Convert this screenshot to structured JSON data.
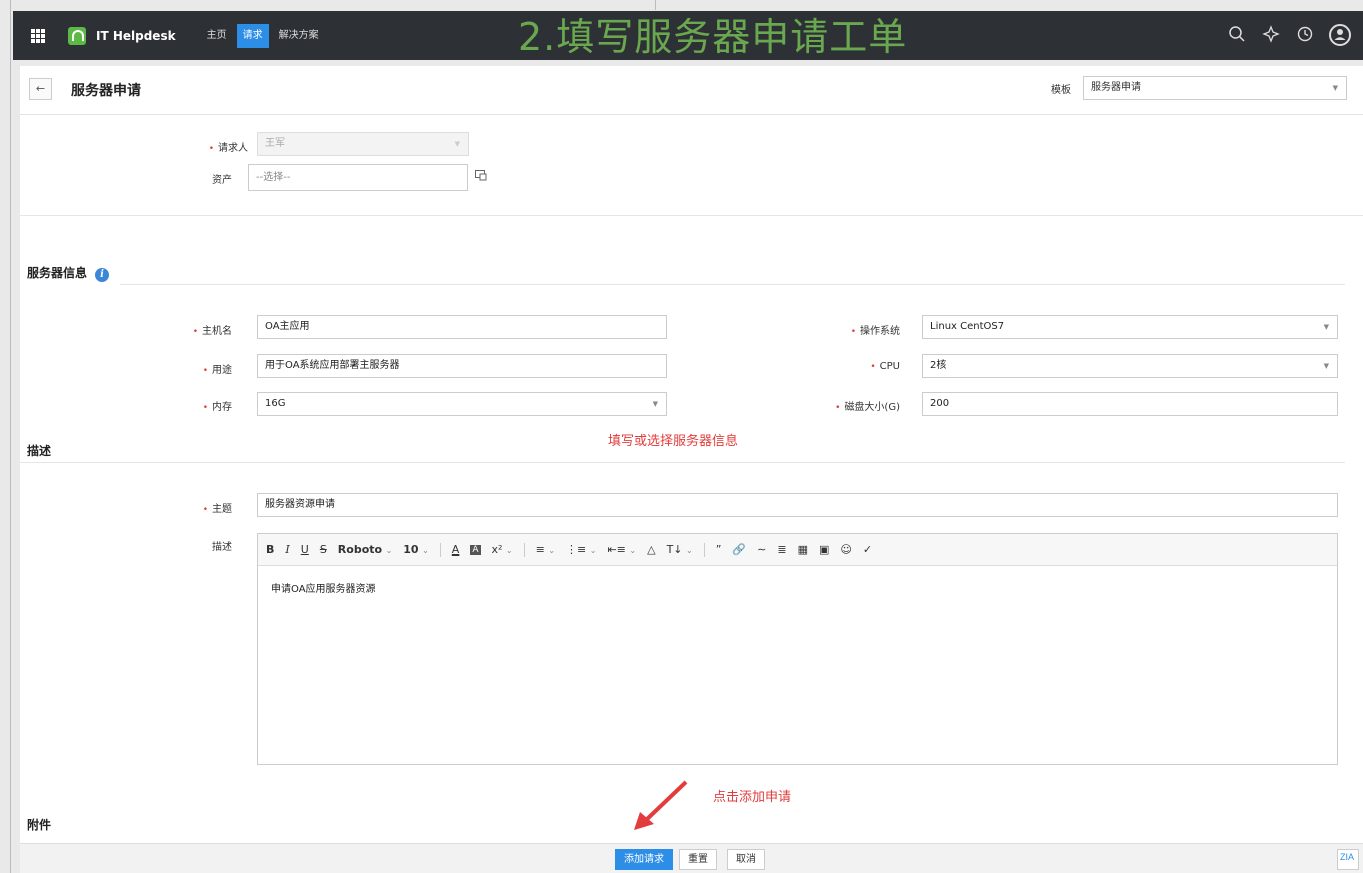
{
  "topbar": {
    "app_name": "IT Helpdesk",
    "nav": [
      "主页",
      "请求",
      "解决方案"
    ],
    "active_nav": "请求",
    "overlay_title": "2.填写服务器申请工单"
  },
  "header": {
    "page_title": "服务器申请",
    "template_label": "模板",
    "template_value": "服务器申请"
  },
  "requester": {
    "requester_label": "请求人",
    "requester_value": "王军",
    "asset_label": "资产",
    "asset_placeholder": "--选择--"
  },
  "server_section": {
    "title": "服务器信息",
    "hostname_label": "主机名",
    "hostname_value": "OA主应用",
    "purpose_label": "用途",
    "purpose_value": "用于OA系统应用部署主服务器",
    "memory_label": "内存",
    "memory_value": "16G",
    "os_label": "操作系统",
    "os_value": "Linux CentOS7",
    "cpu_label": "CPU",
    "cpu_value": "2核",
    "disk_label": "磁盘大小(G)",
    "disk_value": "200",
    "annotation": "填写或选择服务器信息"
  },
  "description_section": {
    "title": "描述",
    "subject_label": "主题",
    "subject_value": "服务器资源申请",
    "desc_label": "描述",
    "toolbar": {
      "bold": "B",
      "italic": "I",
      "underline": "U",
      "strike": "S",
      "font": "Roboto",
      "size": "10",
      "font_color": "A",
      "bg_color": "A",
      "superscript": "x²"
    },
    "body_text": "申请OA应用服务器资源"
  },
  "attachment_section": {
    "title": "附件",
    "annotation": "点击添加申请"
  },
  "footer": {
    "add_label": "添加请求",
    "reset_label": "重置",
    "cancel_label": "取消",
    "zia_label": "ZIA"
  }
}
